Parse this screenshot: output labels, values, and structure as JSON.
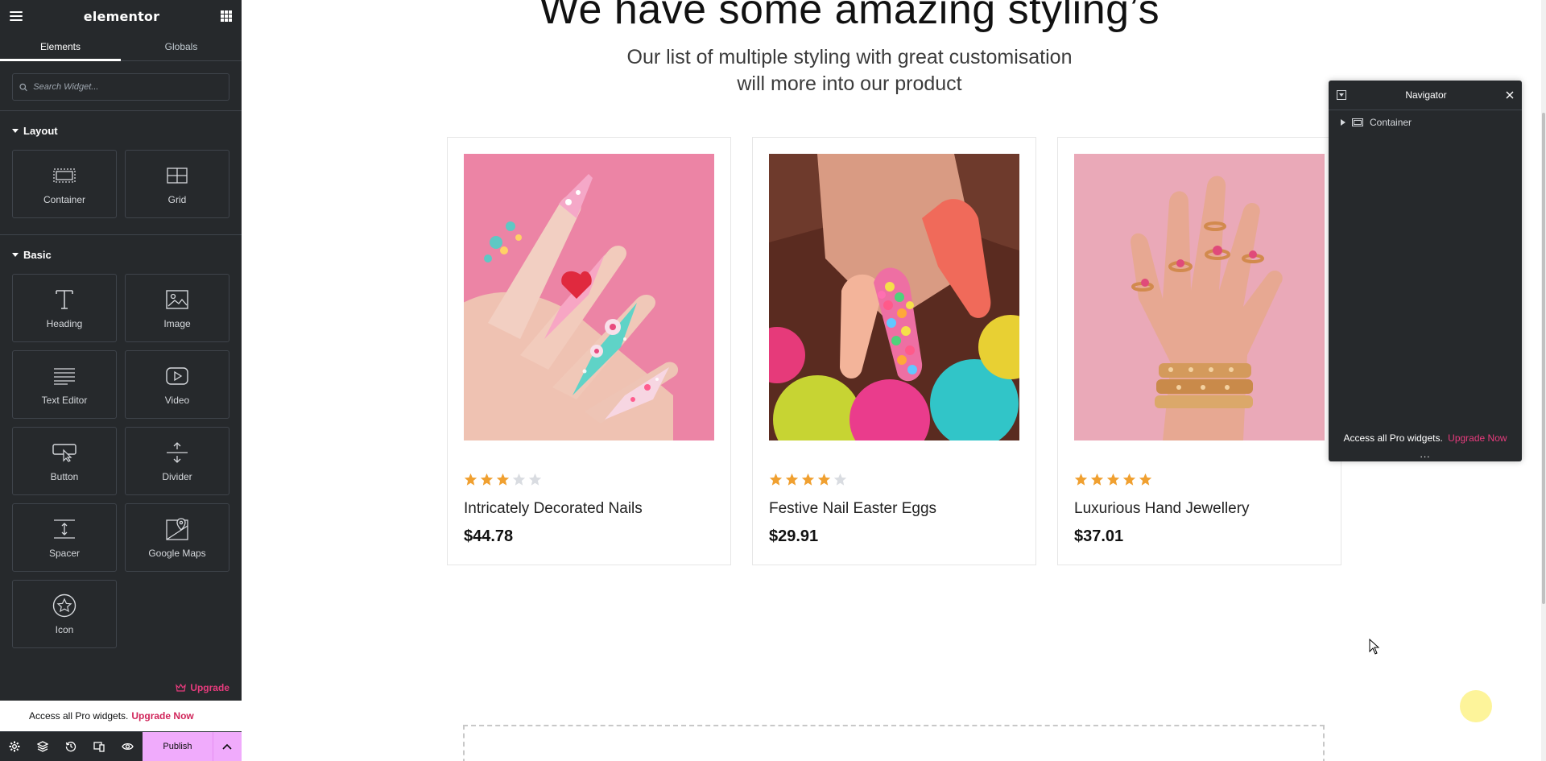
{
  "panel": {
    "brand": "elementor",
    "tabs": [
      "Elements",
      "Globals"
    ],
    "search_placeholder": "Search Widget...",
    "categories": [
      {
        "title": "Layout",
        "widgets": [
          "Container",
          "Grid"
        ]
      },
      {
        "title": "Basic",
        "widgets": [
          "Heading",
          "Image",
          "Text Editor",
          "Video",
          "Button",
          "Divider",
          "Spacer",
          "Google Maps",
          "Icon"
        ]
      }
    ],
    "upgrade_label": "Upgrade",
    "pro_bar_text": "Access all Pro widgets.",
    "pro_bar_link": "Upgrade Now",
    "publish_label": "Publish"
  },
  "section": {
    "title": "We have some amazing styling’s",
    "subtitle_line1": "Our list of multiple styling with great customisation",
    "subtitle_line2": "will more into our product"
  },
  "products": [
    {
      "title": "Intricately Decorated Nails",
      "price": "$44.78",
      "rating": 3
    },
    {
      "title": "Festive Nail Easter Eggs",
      "price": "$29.91",
      "rating": 4
    },
    {
      "title": "Luxurious Hand Jewellery",
      "price": "$37.01",
      "rating": 5
    }
  ],
  "navigator": {
    "title": "Navigator",
    "item": "Container",
    "promo_text": "Access all Pro widgets.",
    "promo_link": "Upgrade Now",
    "dots": "..."
  },
  "colors": {
    "panel_bg": "#26292c",
    "accent_pink": "#e73b7d",
    "publish_bg": "#f0abfc",
    "star_filled": "#f0a030",
    "star_empty": "#d9dce1"
  }
}
